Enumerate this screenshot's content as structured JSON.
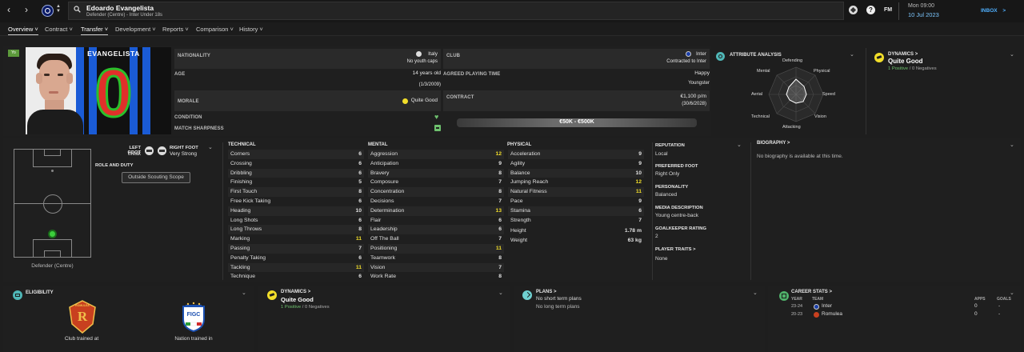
{
  "header": {
    "player_name": "Edoardo Evangelista",
    "player_subtitle": "Defender (Centre) - Inter Under 18s",
    "fm_label": "FM",
    "date_time": "Mon 09:00",
    "date": "10 Jul 2023",
    "inbox": "INBOX",
    "inbox_arrow": ">"
  },
  "tabs": [
    {
      "label": "Overview"
    },
    {
      "label": "Contract"
    },
    {
      "label": "Transfer"
    },
    {
      "label": "Development"
    },
    {
      "label": "Reports"
    },
    {
      "label": "Comparison"
    },
    {
      "label": "History"
    }
  ],
  "profile": {
    "age_badge": "Yo",
    "shirt_name": "EVANGELISTA",
    "shirt_number": "0",
    "nationality_label": "NATIONALITY",
    "nationality": "Italy",
    "youth_caps": "No youth caps",
    "club_label": "CLUB",
    "club": "Inter",
    "club_status": "Contracted to Inter",
    "age_label": "AGE",
    "age": "14 years old",
    "dob": "(1/3/2009)",
    "playing_time_label": "AGREED PLAYING TIME",
    "happiness": "Happy",
    "playing_time": "Youngster",
    "morale_label": "MORALE",
    "morale": "Quite Good",
    "contract_label": "CONTRACT",
    "wage": "€1,100 p/m",
    "contract_end": "(30/6/2028)",
    "condition_label": "CONDITION",
    "sharpness_label": "MATCH SHARPNESS",
    "value_range": "€50K - €500K"
  },
  "attribute_analysis": {
    "title": "ATTRIBUTE ANALYSIS",
    "labels": [
      "Defending",
      "Physical",
      "Speed",
      "Vision",
      "Attacking",
      "Technical",
      "Aerial",
      "Mental"
    ]
  },
  "dynamics_top": {
    "title": "DYNAMICS",
    "arrow": ">",
    "value": "Quite Good",
    "positives": "1 Positive",
    "sep": "/",
    "negatives": "0 Negatives"
  },
  "positions": {
    "left_foot_label": "LEFT FOOT",
    "left_foot": "Weak",
    "right_foot_label": "RIGHT FOOT",
    "right_foot": "Very Strong",
    "role_label": "ROLE AND DUTY",
    "scouting_button": "Outside Scouting Scope",
    "position_caption": "Defender (Centre)"
  },
  "attributes": {
    "technical_title": "TECHNICAL",
    "mental_title": "MENTAL",
    "physical_title": "PHYSICAL",
    "technical": [
      {
        "name": "Corners",
        "value": "6"
      },
      {
        "name": "Crossing",
        "value": "6"
      },
      {
        "name": "Dribbling",
        "value": "6"
      },
      {
        "name": "Finishing",
        "value": "5"
      },
      {
        "name": "First Touch",
        "value": "8"
      },
      {
        "name": "Free Kick Taking",
        "value": "6"
      },
      {
        "name": "Heading",
        "value": "10"
      },
      {
        "name": "Long Shots",
        "value": "6"
      },
      {
        "name": "Long Throws",
        "value": "8"
      },
      {
        "name": "Marking",
        "value": "11"
      },
      {
        "name": "Passing",
        "value": "7"
      },
      {
        "name": "Penalty Taking",
        "value": "6"
      },
      {
        "name": "Tackling",
        "value": "11"
      },
      {
        "name": "Technique",
        "value": "6"
      }
    ],
    "mental": [
      {
        "name": "Aggression",
        "value": "12"
      },
      {
        "name": "Anticipation",
        "value": "9"
      },
      {
        "name": "Bravery",
        "value": "8"
      },
      {
        "name": "Composure",
        "value": "7"
      },
      {
        "name": "Concentration",
        "value": "8"
      },
      {
        "name": "Decisions",
        "value": "7"
      },
      {
        "name": "Determination",
        "value": "13"
      },
      {
        "name": "Flair",
        "value": "6"
      },
      {
        "name": "Leadership",
        "value": "6"
      },
      {
        "name": "Off The Ball",
        "value": "7"
      },
      {
        "name": "Positioning",
        "value": "11"
      },
      {
        "name": "Teamwork",
        "value": "8"
      },
      {
        "name": "Vision",
        "value": "7"
      },
      {
        "name": "Work Rate",
        "value": "8"
      }
    ],
    "physical": [
      {
        "name": "Acceleration",
        "value": "9"
      },
      {
        "name": "Agility",
        "value": "9"
      },
      {
        "name": "Balance",
        "value": "10"
      },
      {
        "name": "Jumping Reach",
        "value": "12"
      },
      {
        "name": "Natural Fitness",
        "value": "11"
      },
      {
        "name": "Pace",
        "value": "9"
      },
      {
        "name": "Stamina",
        "value": "6"
      },
      {
        "name": "Strength",
        "value": "7"
      }
    ],
    "height_label": "Height",
    "height": "1.78 m",
    "weight_label": "Weight",
    "weight": "63 kg"
  },
  "info": {
    "reputation_label": "REPUTATION",
    "reputation": "Local",
    "preferred_foot_label": "PREFERRED FOOT",
    "preferred_foot": "Right Only",
    "personality_label": "PERSONALITY",
    "personality": "Balanced",
    "media_label": "MEDIA DESCRIPTION",
    "media": "Young centre-back",
    "gk_rating_label": "GOALKEEPER RATING",
    "gk_rating": "2",
    "traits_label": "PLAYER TRAITS",
    "traits_arrow": ">",
    "traits": "None"
  },
  "biography": {
    "title": "BIOGRAPHY",
    "arrow": ">",
    "text": "No biography is available at this time."
  },
  "eligibility": {
    "title": "ELIGIBILITY",
    "club_caption": "Club trained at",
    "club_logo_letter": "R",
    "club_logo_text": "ROMULEA",
    "nation_caption": "Nation trained in",
    "nation_logo_text": "FIGC"
  },
  "dynamics_bottom": {
    "title": "DYNAMICS",
    "arrow": ">",
    "value": "Quite Good",
    "positives": "1 Positive",
    "sep": "/",
    "negatives": "0 Negatives"
  },
  "plans": {
    "title": "PLANS",
    "arrow": ">",
    "short": "No short term plans",
    "long": "No long term plans"
  },
  "career": {
    "title": "CAREER STATS",
    "arrow": ">",
    "year_col": "YEAR",
    "team_col": "TEAM",
    "apps_col": "APPS",
    "goals_col": "GOALS",
    "rows": [
      {
        "year": "23-24",
        "team": "Inter",
        "apps": "0",
        "goals": "-"
      },
      {
        "year": "20-23",
        "team": "Romulea",
        "apps": "0",
        "goals": "-"
      }
    ]
  },
  "colors": {
    "accent": "#6fd0d0",
    "positive": "#6ec16e",
    "highlight": "#f2de2a",
    "shirt_red": "#e0302a",
    "shirt_blue": "#1a5bd6"
  },
  "icons": [
    "back-icon",
    "forward-icon",
    "club-crest-icon",
    "search-icon",
    "ball-icon",
    "help-icon",
    "heart-icon",
    "sharpness-icon"
  ]
}
